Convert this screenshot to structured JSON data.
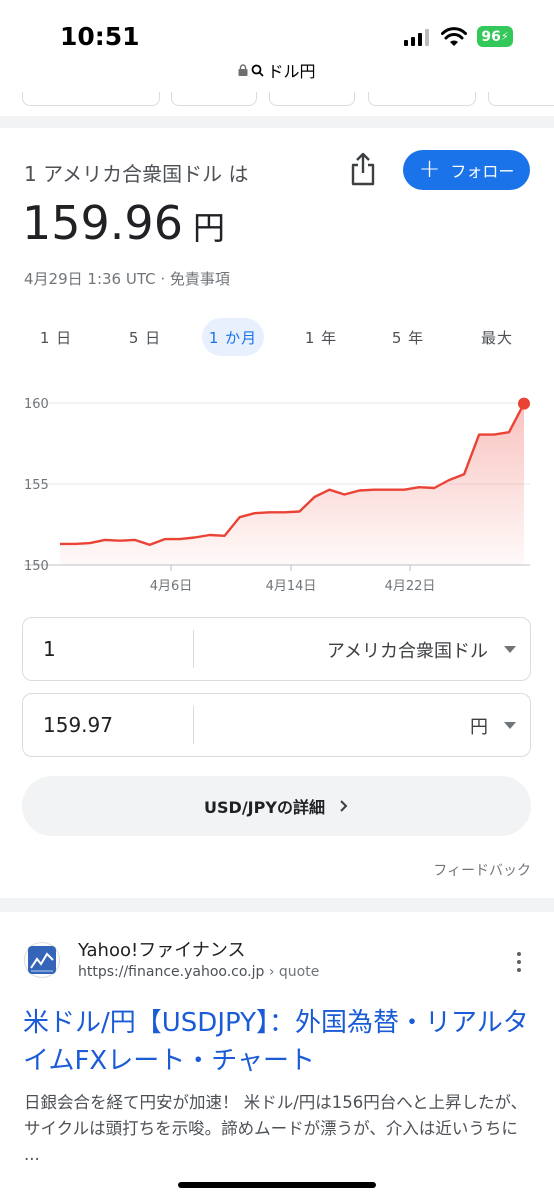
{
  "status_bar": {
    "time": "10:51",
    "battery": "96",
    "url_text": "ドル円"
  },
  "card": {
    "title": "1 アメリカ合衆国ドル は",
    "follow_label": "フォロー",
    "price": "159.96",
    "price_unit": "円",
    "timestamp": "4月29日 1:36 UTC · 免責事項",
    "ranges": [
      "1 日",
      "5 日",
      "1 か月",
      "1 年",
      "5 年",
      "最大"
    ],
    "active_range": "1 か月"
  },
  "chart_data": {
    "type": "area",
    "x_tick_labels": [
      "4月6日",
      "4月14日",
      "4月22日"
    ],
    "y_tick_labels": [
      "160",
      "155",
      "150"
    ],
    "ylim": [
      150,
      161
    ],
    "line_color": "#ea4335",
    "series": [
      {
        "values": [
          151.3,
          151.3,
          151.35,
          151.55,
          151.5,
          151.55,
          151.25,
          151.6,
          151.6,
          151.7,
          151.85,
          151.8,
          152.95,
          153.2,
          153.25,
          153.25,
          153.3,
          154.2,
          154.65,
          154.35,
          154.6,
          154.65,
          154.65,
          154.65,
          154.8,
          154.75,
          155.25,
          155.6,
          158.05,
          158.05,
          158.2,
          159.96
        ]
      }
    ]
  },
  "converter": {
    "from_value": "1",
    "from_currency": "アメリカ合衆国ドル",
    "to_value": "159.97",
    "to_currency": "円"
  },
  "details_label": "USD/JPYの詳細",
  "feedback_label": "フィードバック",
  "result": {
    "site_name": "Yahoo!ファイナンス",
    "url": "https://finance.yahoo.co.jp",
    "url_crumb": "› quote",
    "title": "米ドル/円【USDJPY】：外国為替・リアルタイムFXレート・チャート",
    "snippet": "日銀会合を経て円安が加速！ 米ドル/円は156円台へと上昇したが、サイクルは頭打ちを示唆。諦めムードが漂うが、介入は近いうちに ..."
  }
}
